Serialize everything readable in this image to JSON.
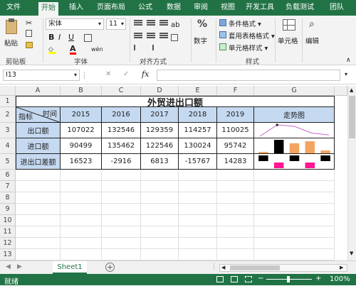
{
  "ribbon_tabs": [
    "文件",
    "开始",
    "插入",
    "页面布局",
    "公式",
    "数据",
    "审阅",
    "视图",
    "开发工具",
    "负载测试",
    "团队"
  ],
  "ribbon": {
    "paste": "粘贴",
    "clipboard": "剪贴板",
    "font_name": "宋体",
    "font_size": "11",
    "font_group": "字体",
    "bold": "B",
    "italic": "I",
    "underline": "U",
    "font_color_glyph": "A",
    "wen": "wén",
    "alignment_group": "对齐方式",
    "number": "数字",
    "percent": "%",
    "conditional_format": "条件格式",
    "table_format": "套用表格格式",
    "cell_style": "单元格样式",
    "styles_group": "样式",
    "cells": "单元格",
    "editing": "编辑"
  },
  "formula_bar": {
    "name_box": "I13",
    "fx": "fx",
    "cancel": "✕",
    "enter": "✓"
  },
  "columns": [
    "A",
    "B",
    "C",
    "D",
    "E",
    "F",
    "G"
  ],
  "rows": [
    "1",
    "2",
    "3",
    "4",
    "5",
    "6",
    "7",
    "8",
    "9",
    "10",
    "11",
    "12",
    "13"
  ],
  "table": {
    "title": "外贸进出口额",
    "corner_top": "时间",
    "corner_bottom": "指标",
    "years": [
      "2015",
      "2016",
      "2017",
      "2018",
      "2019"
    ],
    "trend_header": "走势图",
    "data_rows": [
      {
        "label": "出口额",
        "values": [
          "107022",
          "132546",
          "129359",
          "114257",
          "110025"
        ]
      },
      {
        "label": "进口额",
        "values": [
          "90499",
          "135462",
          "122546",
          "130024",
          "95742"
        ]
      },
      {
        "label": "进出口差额",
        "values": [
          "16523",
          "-2916",
          "6813",
          "-15767",
          "14283"
        ]
      }
    ]
  },
  "sparkline_colors": {
    "line": "#cc66cc",
    "line_marker": "#333333",
    "column_high": "#000000",
    "column_normal": "#f4a460",
    "winloss_positive": "#000000",
    "winloss_negative": "#ff1493"
  },
  "sheet_tabs": {
    "active": "Sheet1"
  },
  "status": {
    "text": "就绪",
    "zoom": "100%"
  }
}
